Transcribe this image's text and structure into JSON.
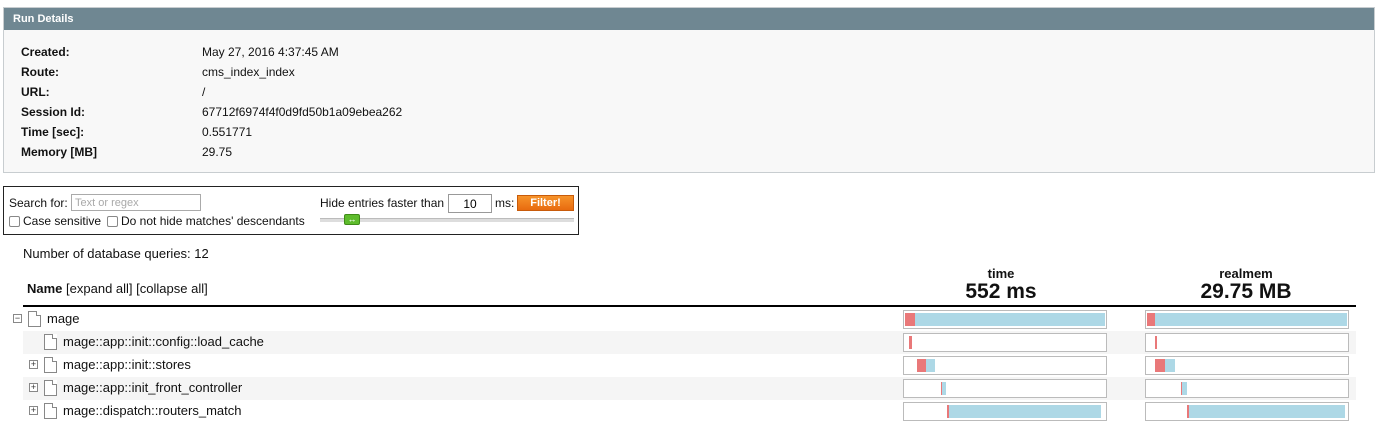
{
  "run_details": {
    "title": "Run Details",
    "rows": [
      {
        "label": "Created:",
        "value": "May 27, 2016 4:37:45 AM"
      },
      {
        "label": "Route:",
        "value": "cms_index_index"
      },
      {
        "label": "URL:",
        "value": "/"
      },
      {
        "label": "Session Id:",
        "value": "67712f6974f4f0d9fd50b1a09ebea262"
      },
      {
        "label": "Time [sec]:",
        "value": "0.551771"
      },
      {
        "label": "Memory [MB]",
        "value": "29.75"
      }
    ]
  },
  "filter": {
    "search_label": "Search for:",
    "search_placeholder": "Text or regex",
    "case_sensitive_label": "Case sensitive",
    "no_hide_label": "Do not hide matches' descendants",
    "hide_label": "Hide entries faster than",
    "threshold": "10",
    "ms_label": "ms:",
    "button_label": "Filter!"
  },
  "profile": {
    "db_queries": "Number of database queries: 12",
    "name_label": "Name",
    "expand_all": "[expand all]",
    "collapse_all": "[collapse all]",
    "time_header": "time",
    "time_total": "552 ms",
    "mem_header": "realmem",
    "mem_total": "29.75 MB",
    "colors": {
      "own": "#e97879",
      "children": "#add8e6"
    },
    "nodes": [
      {
        "name": "mage",
        "depth": 0,
        "toggle": "−",
        "time": {
          "start": 0,
          "own": 0.05,
          "children": 0.95
        },
        "mem": {
          "start": 0,
          "own": 0.04,
          "children": 0.96
        }
      },
      {
        "name": "mage::app::init::config::load_cache",
        "depth": 1,
        "toggle": "",
        "time": {
          "start": 0.02,
          "own": 0.015,
          "children": 0
        },
        "mem": {
          "start": 0.04,
          "own": 0.01,
          "children": 0
        }
      },
      {
        "name": "mage::app::init::stores",
        "depth": 1,
        "toggle": "+",
        "time": {
          "start": 0.06,
          "own": 0.045,
          "children": 0.045
        },
        "mem": {
          "start": 0.04,
          "own": 0.05,
          "children": 0.05
        }
      },
      {
        "name": "mage::app::init_front_controller",
        "depth": 1,
        "toggle": "+",
        "time": {
          "start": 0.18,
          "own": 0.005,
          "children": 0.02
        },
        "mem": {
          "start": 0.17,
          "own": 0.005,
          "children": 0.025
        }
      },
      {
        "name": "mage::dispatch::routers_match",
        "depth": 1,
        "toggle": "+",
        "time": {
          "start": 0.21,
          "own": 0.008,
          "children": 0.76
        },
        "mem": {
          "start": 0.2,
          "own": 0.008,
          "children": 0.78
        }
      }
    ]
  }
}
